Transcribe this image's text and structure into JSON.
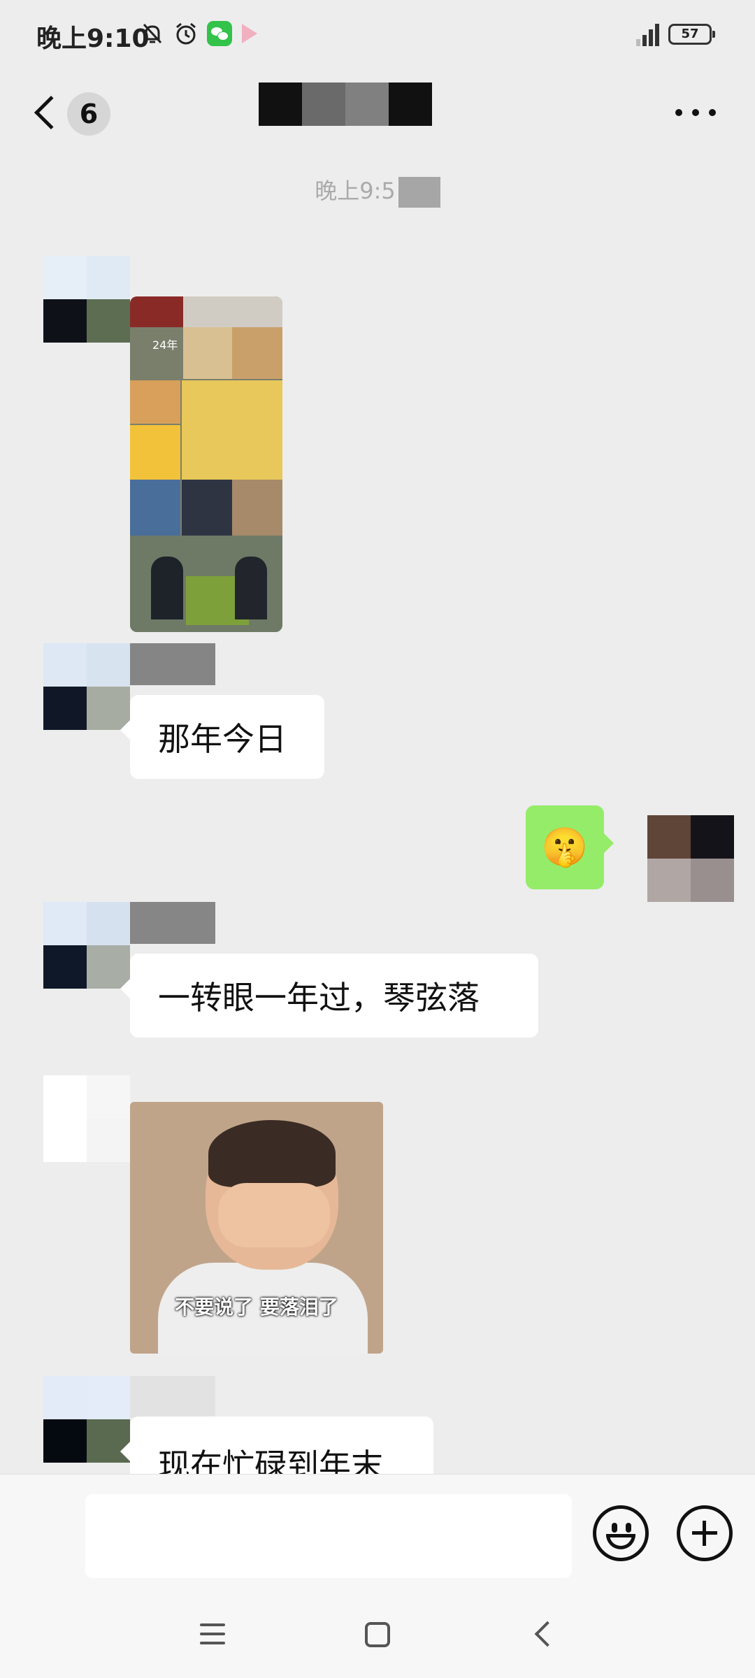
{
  "status_bar": {
    "time": "晚上9:10",
    "battery": "57",
    "icons": [
      "mute-bell-icon",
      "alarm-icon",
      "wechat-icon",
      "play-store-icon",
      "signal-icon",
      "battery-icon"
    ]
  },
  "header": {
    "unread_count": "6",
    "back_icon": "chevron-left-icon",
    "more_icon": "more-dots-icon"
  },
  "chat": {
    "timestamp": "晚上9:5",
    "messages": [
      {
        "from": "other",
        "type": "image",
        "content": "photo-collage",
        "date_text": "24年"
      },
      {
        "from": "other",
        "type": "text",
        "text": "那年今日"
      },
      {
        "from": "me",
        "type": "emoji",
        "text": "🤫"
      },
      {
        "from": "other",
        "type": "text",
        "text": "一转眼一年过，琴弦落"
      },
      {
        "from": "other",
        "type": "sticker",
        "caption": "不要说了 要落泪了"
      },
      {
        "from": "other",
        "type": "text",
        "text": "现在忙碌到年末"
      }
    ]
  },
  "input_bar": {
    "placeholder": "",
    "emoji_icon": "emoji-icon",
    "plus_icon": "plus-circle-icon"
  },
  "nav_bar": {
    "icons": [
      "menu-icon",
      "home-square-icon",
      "back-triangle-icon"
    ]
  },
  "colors": {
    "background": "#ededed",
    "sent_bubble": "#95ec69",
    "received_bubble": "#ffffff"
  }
}
